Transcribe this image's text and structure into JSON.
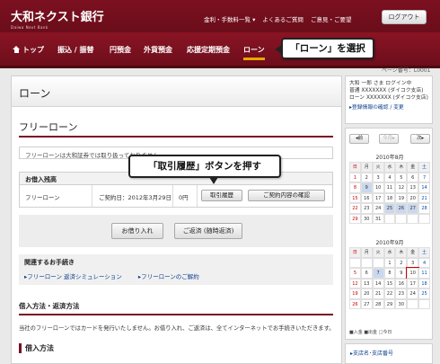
{
  "header": {
    "bank_name": "大和ネクスト銀行",
    "bank_name_en": "Daiwa Next Bank",
    "utility_links": [
      "金利・手数料一覧 ▾",
      "よくあるご質問",
      "ご意見・ご要望"
    ],
    "logout_label": "ログアウト"
  },
  "nav": {
    "items": [
      "トップ",
      "振込 / 振替",
      "円預金",
      "外貨預金",
      "応援定期預金",
      "ローン"
    ],
    "active": "ローン"
  },
  "annotations": {
    "select_loan": "「ローン」を選択",
    "press_history": "「取引履歴」ボタンを押す"
  },
  "page_number": "ページ番号：L0001",
  "main": {
    "page_title": "ローン",
    "section_title": "フリーローン",
    "notice": "フリーローンは大和証券では取り扱っておりません",
    "balance": {
      "heading": "お借入残高",
      "loan_name": "フリーローン",
      "contract_date": "ご契約日：2012年3月29日",
      "amount": "0円",
      "history_button": "取引履歴",
      "confirm_button": "ご契約内容の確認"
    },
    "borrow_button": "お借り入れ",
    "repay_button": "ご返済 (随時返済)",
    "related": {
      "title": "関連するお手続き",
      "links": [
        "フリーローン 返済シミュレーション",
        "フリーローンのご解約"
      ]
    },
    "method_title": "借入方法・返済方法",
    "method_text": "当社のフリーローンではカードを発行いたしません。お借り入れ、ご返済は、全てインターネットでお手続きいただきます。",
    "borrow_method_title": "借入方法"
  },
  "sidebar": {
    "account_lines": [
      "大和 一郎 さま ログイン中",
      "普通 XXXXXXX (ダイコク支店)",
      "ローン XXXXXXX (ダイコク支店)"
    ],
    "account_link": "登録情報の確認 / 変更",
    "calendar": {
      "prev": "前",
      "this_month": "今月",
      "next": "次",
      "weekdays": [
        "日",
        "月",
        "火",
        "水",
        "木",
        "金",
        "土"
      ],
      "month1": "2010年8月",
      "month1_days": [
        "1",
        "2",
        "3",
        "4",
        "5",
        "6",
        "7",
        "8",
        "9",
        "10",
        "11",
        "12",
        "13",
        "14",
        "15",
        "16",
        "17",
        "18",
        "19",
        "20",
        "21",
        "22",
        "23",
        "24",
        "25",
        "26",
        "27",
        "28",
        "29",
        "30",
        "31",
        "",
        "",
        "",
        ""
      ],
      "month2": "2010年9月",
      "month2_days": [
        "",
        "",
        "",
        "1",
        "2",
        "3",
        "4",
        "5",
        "6",
        "7",
        "8",
        "9",
        "10",
        "11",
        "12",
        "13",
        "14",
        "15",
        "16",
        "17",
        "18",
        "19",
        "20",
        "21",
        "22",
        "23",
        "24",
        "25",
        "26",
        "27",
        "28",
        "29",
        "30",
        "",
        ""
      ],
      "legend": "■入金 ■出金 □今日"
    },
    "branch_link": "支店名･支店番号"
  }
}
